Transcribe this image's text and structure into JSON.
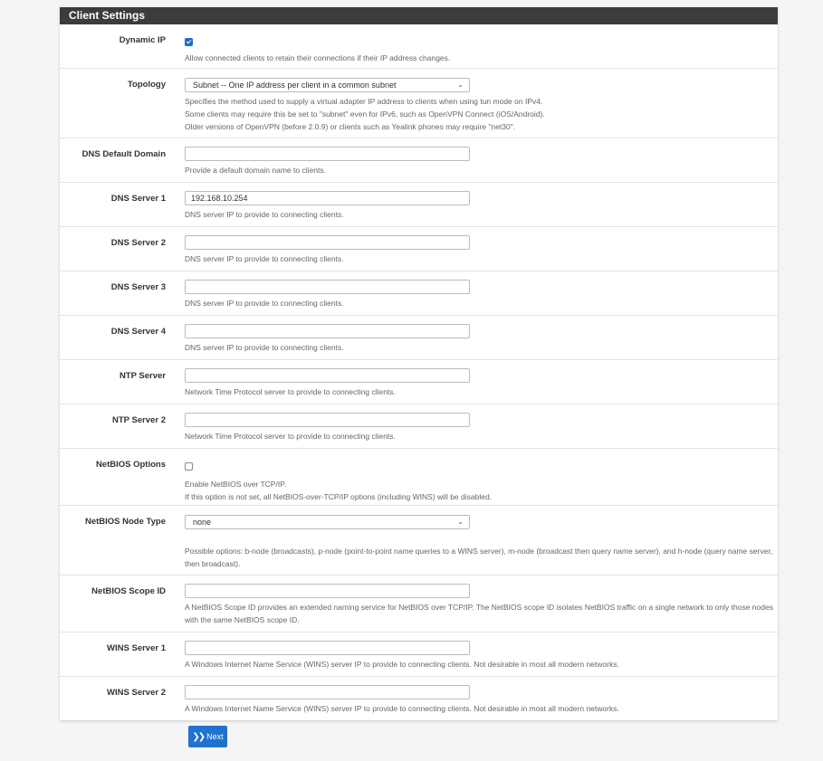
{
  "panel": {
    "title": "Client Settings"
  },
  "rows": {
    "dynamic_ip": {
      "label": "Dynamic IP",
      "checked": true,
      "help": [
        "Allow connected clients to retain their connections if their IP address changes."
      ]
    },
    "topology": {
      "label": "Topology",
      "value": "Subnet -- One IP address per client in a common subnet",
      "help": [
        "Specifies the method used to supply a virtual adapter IP address to clients when using tun mode on IPv4.",
        "Some clients may require this be set to \"subnet\" even for IPv6, such as OpenVPN Connect (iOS/Android).",
        "Older versions of OpenVPN (before 2.0.9) or clients such as Yealink phones may require \"net30\"."
      ]
    },
    "dns_default_domain": {
      "label": "DNS Default Domain",
      "value": "",
      "help": [
        "Provide a default domain name to clients."
      ]
    },
    "dns_server_1": {
      "label": "DNS Server 1",
      "value": "192.168.10.254",
      "help": [
        "DNS server IP to provide to connecting clients."
      ]
    },
    "dns_server_2": {
      "label": "DNS Server 2",
      "value": "",
      "help": [
        "DNS server IP to provide to connecting clients."
      ]
    },
    "dns_server_3": {
      "label": "DNS Server 3",
      "value": "",
      "help": [
        "DNS server IP to provide to connecting clients."
      ]
    },
    "dns_server_4": {
      "label": "DNS Server 4",
      "value": "",
      "help": [
        "DNS server IP to provide to connecting clients."
      ]
    },
    "ntp_server": {
      "label": "NTP Server",
      "value": "",
      "help": [
        "Network Time Protocol server to provide to connecting clients."
      ]
    },
    "ntp_server_2": {
      "label": "NTP Server 2",
      "value": "",
      "help": [
        "Network Time Protocol server to provide to connecting clients."
      ]
    },
    "netbios_options": {
      "label": "NetBIOS Options",
      "checked": false,
      "help": [
        "Enable NetBIOS over TCP/IP.",
        "If this option is not set, all NetBIOS-over-TCP/IP options (including WINS) will be disabled."
      ]
    },
    "netbios_node_type": {
      "label": "NetBIOS Node Type",
      "value": "none",
      "help": [
        "Possible options: b-node (broadcasts), p-node (point-to-point name queries to a WINS server), m-node (broadcast then query name server), and h-node (query name server, then broadcast)."
      ]
    },
    "netbios_scope_id": {
      "label": "NetBIOS Scope ID",
      "value": "",
      "help": [
        "A NetBIOS Scope ID provides an extended naming service for NetBIOS over TCP/IP. The NetBIOS scope ID isolates NetBIOS traffic on a single network to only those nodes with the same NetBIOS scope ID."
      ]
    },
    "wins_server_1": {
      "label": "WINS Server 1",
      "value": "",
      "help": [
        "A Windows Internet Name Service (WINS) server IP to provide to connecting clients. Not desirable in most all modern networks."
      ]
    },
    "wins_server_2": {
      "label": "WINS Server 2",
      "value": "",
      "help": [
        "A Windows Internet Name Service (WINS) server IP to provide to connecting clients. Not desirable in most all modern networks."
      ]
    }
  },
  "icons": {
    "next": "double-chevron-right-icon",
    "select": "chevron-down-icon"
  },
  "next_button": {
    "label": "Next"
  },
  "colors": {
    "header_bg": "#3c3c3c",
    "accent": "#1f72cf"
  }
}
